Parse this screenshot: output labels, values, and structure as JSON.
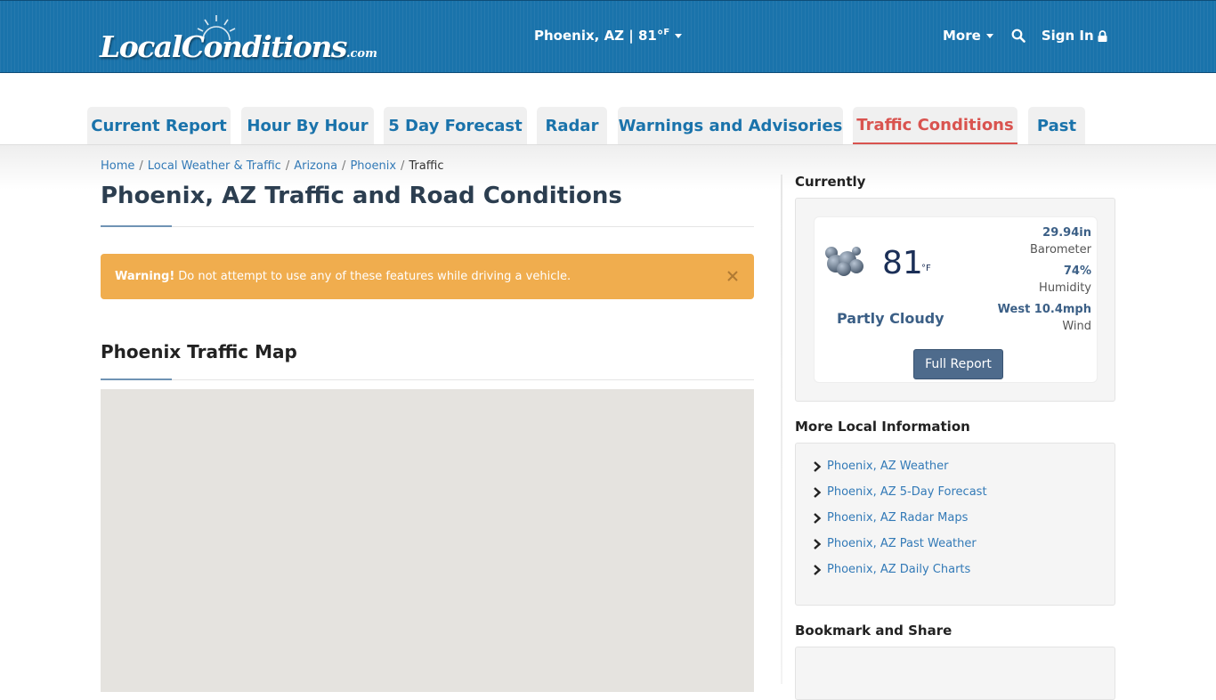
{
  "header": {
    "logo_text": "LocalConditions",
    "logo_suffix": ".com",
    "location": "Phoenix, AZ | 81°",
    "location_unit": "F",
    "more_label": "More",
    "signin_label": "Sign In"
  },
  "tabs": [
    {
      "label": "Current Report"
    },
    {
      "label": "Hour By Hour"
    },
    {
      "label": "5 Day Forecast"
    },
    {
      "label": "Radar"
    },
    {
      "label": "Warnings and Advisories"
    },
    {
      "label": "Traffic Conditions",
      "active": true
    },
    {
      "label": "Past"
    }
  ],
  "breadcrumb": {
    "items": [
      "Home",
      "Local Weather & Traffic",
      "Arizona",
      "Phoenix"
    ],
    "current": "Traffic",
    "separator": "/"
  },
  "main": {
    "title": "Phoenix, AZ Traffic and Road Conditions",
    "alert_strong": "Warning!",
    "alert_text": "Do not attempt to use any of these features while driving a vehicle.",
    "alert_close": "×",
    "map_title": "Phoenix Traffic Map"
  },
  "sidebar": {
    "currently_heading": "Currently",
    "weather": {
      "icon": "partly-cloudy-icon",
      "temp": "81",
      "temp_unit": "°F",
      "condition": "Partly Cloudy",
      "barometer_value": "29.94in",
      "barometer_label": "Barometer",
      "humidity_value": "74%",
      "humidity_label": "Humidity",
      "wind_value": "West 10.4mph",
      "wind_label": "Wind",
      "button_label": "Full Report"
    },
    "more_info_heading": "More Local Information",
    "links": [
      {
        "label": "Phoenix, AZ Weather"
      },
      {
        "label": "Phoenix, AZ 5-Day Forecast"
      },
      {
        "label": "Phoenix, AZ Radar Maps"
      },
      {
        "label": "Phoenix, AZ Past Weather"
      },
      {
        "label": "Phoenix, AZ Daily Charts"
      }
    ],
    "bookmark_heading": "Bookmark and Share"
  },
  "colors": {
    "header_blue": "#1a73ab",
    "tab_link": "#1a73ab",
    "tab_active": "#d9534f",
    "warning": "#f0ad4e",
    "link": "#337ab7",
    "button": "#4e6b8c"
  }
}
